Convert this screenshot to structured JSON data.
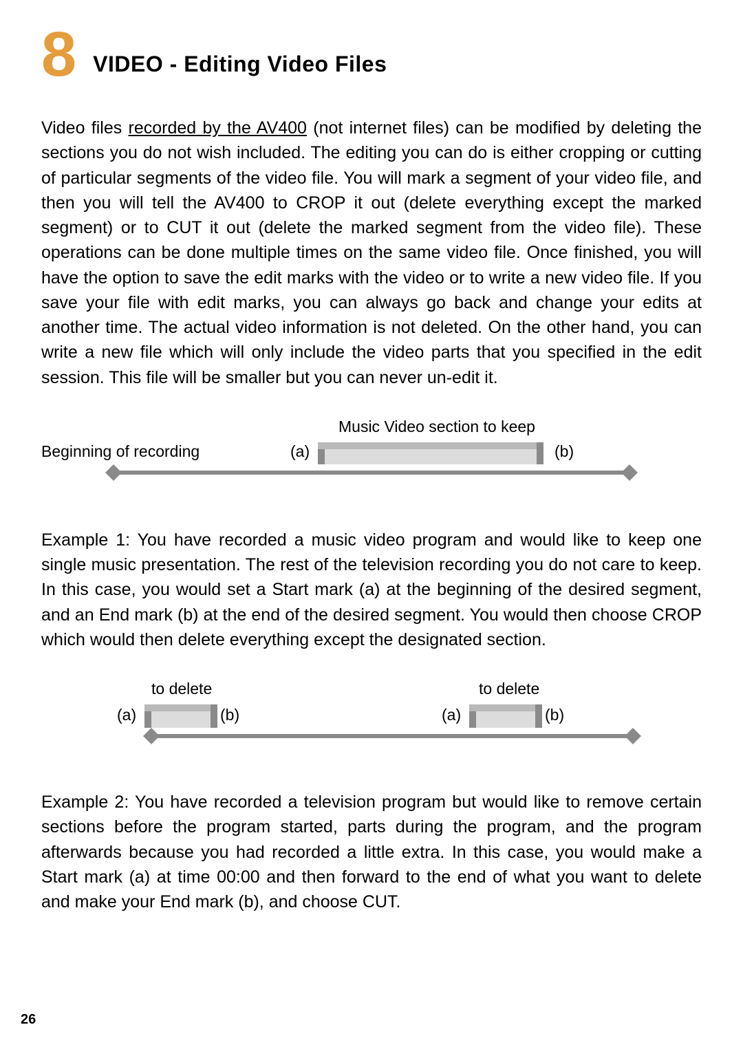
{
  "chapter": {
    "num": "8",
    "title": "VIDEO - Editing Video Files"
  },
  "para1_before": "Video files ",
  "para1_underlined": "recorded by the AV400",
  "para1_after": " (not internet files) can be modified by deleting the sections you do not wish included. The editing you can do is either cropping or cutting of particular segments of the video file. You will mark a segment of your video file, and then you will tell the AV400 to CROP it out (delete everything except the marked segment) or to CUT it out (delete the marked segment from the video file). These operations can be done multiple times on the same video file. Once finished, you will have the option to save the edit marks with the video or to write a new video file. If you save your file with edit marks, you can always go back and change your edits at another time. The actual video information is not deleted. On the other hand, you can write a new file which will only include the video parts that you specified in the edit session. This file will be smaller but you can never un-edit it.",
  "diag1": {
    "top_label": "Music Video section to keep",
    "left_label": "Beginning of recording",
    "a": "(a)",
    "b": "(b)"
  },
  "para2": "Example 1: You have recorded a music video program and would like to keep one single music presentation. The rest of the television recording you do not care to keep. In this case, you would set a Start mark (a) at the beginning of the desired segment, and an End mark (b) at the end of the desired segment. You would then choose CROP which would then delete everything except the designated section.",
  "diag2": {
    "delete1": "to delete",
    "delete2": "to delete",
    "a1": "(a)",
    "b1": "(b)",
    "a2": "(a)",
    "b2": "(b)"
  },
  "para3": "Example 2: You have recorded a television program but would like to remove certain sections before the program started, parts during the program, and the program afterwards because you had recorded a little extra. In this case, you would make a Start mark (a) at time 00:00 and then forward to the end of what you want to delete and make your End mark (b), and choose CUT.",
  "page_number": "26"
}
